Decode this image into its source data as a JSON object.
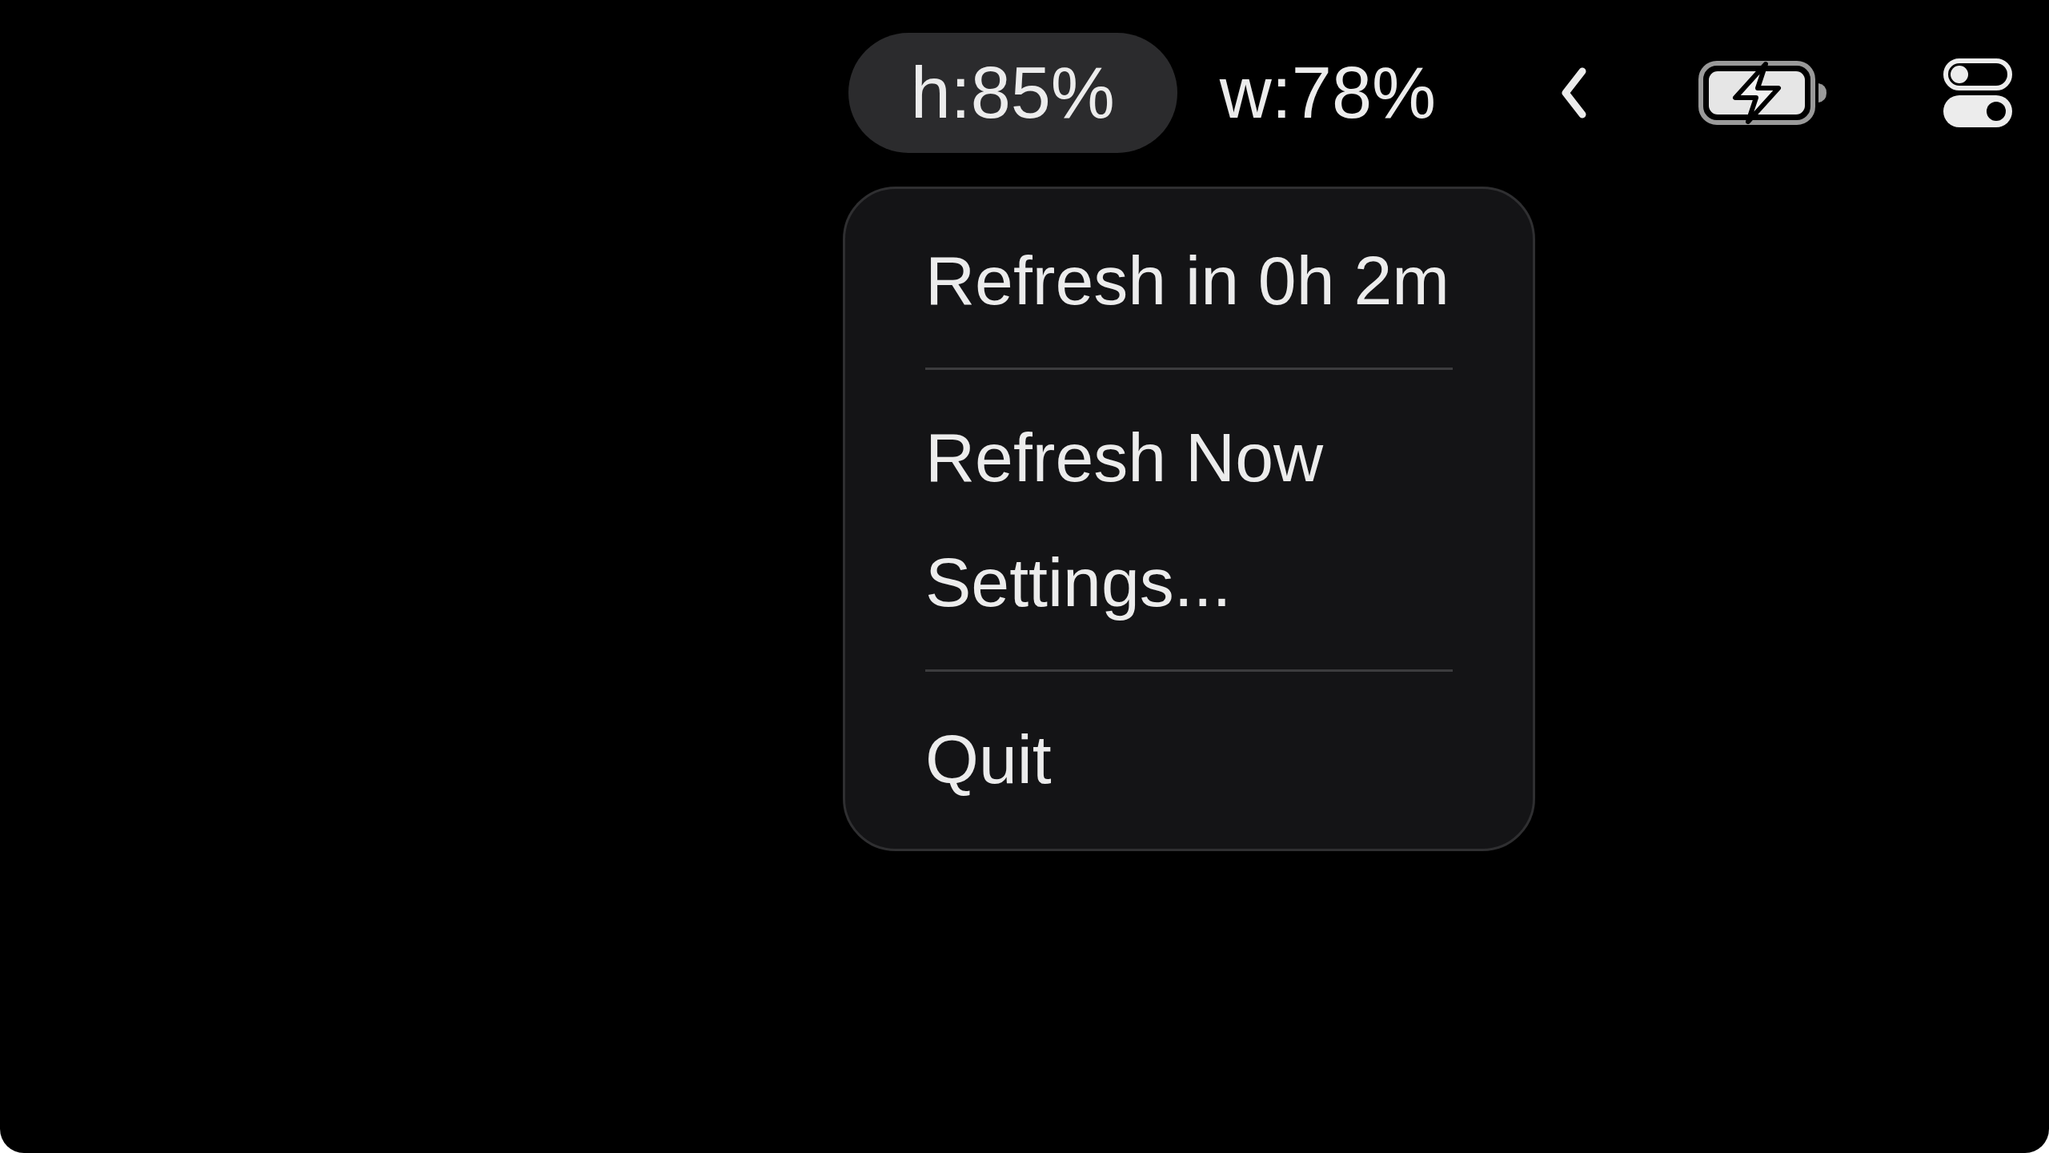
{
  "menu_bar": {
    "items": [
      {
        "kind": "text",
        "label": "h:85%",
        "selected": true
      },
      {
        "kind": "text",
        "label": "w:78%",
        "selected": false
      },
      {
        "kind": "chevron"
      },
      {
        "kind": "battery",
        "charging": true
      },
      {
        "kind": "control_center"
      }
    ]
  },
  "menu": {
    "entries": [
      {
        "kind": "item",
        "label": "Refresh in 0h 2m"
      },
      {
        "kind": "separator"
      },
      {
        "kind": "item",
        "label": "Refresh Now"
      },
      {
        "kind": "item",
        "label": "Settings..."
      },
      {
        "kind": "separator"
      },
      {
        "kind": "item",
        "label": "Quit"
      }
    ]
  }
}
